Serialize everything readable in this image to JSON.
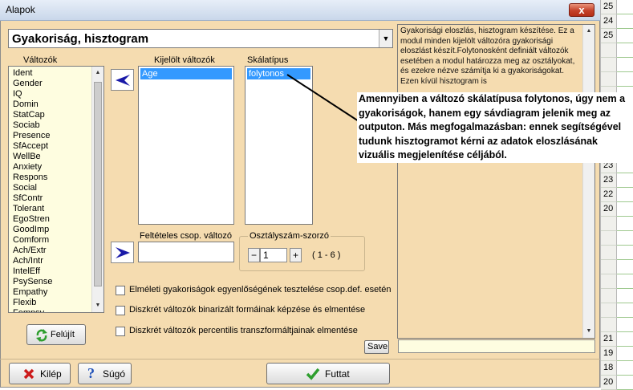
{
  "window": {
    "title": "Alapok",
    "close_label": "x"
  },
  "module_select": {
    "value": "Gyakoriság, hisztogram"
  },
  "variables": {
    "label": "Változók",
    "items": [
      "Ident",
      "Gender",
      "IQ",
      "Domin",
      "StatCap",
      "Sociab",
      "Presence",
      "SfAccept",
      "WellBe",
      "Anxiety",
      "Respons",
      "Social",
      "SfContr",
      "Tolerant",
      "EgoStren",
      "GoodImp",
      "Comform",
      "Ach/Extr",
      "Ach/Intr",
      "IntelEff",
      "PsySense",
      "Empathy",
      "Flexib",
      "Fempsy"
    ]
  },
  "selected_variables": {
    "label": "Kijelölt változók",
    "items": [
      "Age"
    ]
  },
  "scale_type": {
    "label": "Skálatípus",
    "items": [
      "folytonos"
    ]
  },
  "conditional": {
    "label": "Feltételes csop. változó",
    "value": ""
  },
  "class_multiplier": {
    "label": "Osztályszám-szorzó",
    "value": "1",
    "minus": "−",
    "plus": "+",
    "range": "( 1 - 6 )"
  },
  "options": [
    {
      "label": "Elméleti gyakoriságok egyenlőségének tesztelése csop.def. esetén",
      "checked": false
    },
    {
      "label": "Diszkrét változók binarizált formáinak képzése és elmentése",
      "checked": false
    },
    {
      "label": "Diszkrét változók percentilis transzformáltjainak elmentése",
      "checked": false
    }
  ],
  "buttons": {
    "refresh": "Felújít",
    "save": "Save",
    "exit": "Kilép",
    "help": "Súgó",
    "run": "Futtat"
  },
  "description": "Gyakorisági eloszlás, hisztogram készítése. Ez a modul minden kijelölt változóra gyakorisági eloszlást készít.Folytonosként definiált változók esetében a modul határozza meg az osztályokat, és ezekre nézve számítja ki a gyakoriságokat. Ezen kívül hisztogram is",
  "annotation": "Amennyiben a változó skálatípusa folytonos, úgy nem a gyakoriságok, hanem egy sávdiagram jelenik meg az outputon. Más megfogalmazásban: ennek segítségével tudunk hisztogramot kérni az adatok eloszlásának vizuális megjelenítése céljából.",
  "sheet_rows": [
    "25",
    "24",
    "25",
    "",
    "",
    "",
    "",
    "",
    "",
    "",
    "",
    "23",
    "23",
    "22",
    "20",
    "",
    "",
    "",
    "",
    "",
    "",
    "",
    "",
    "21",
    "19",
    "18",
    "20"
  ],
  "colors": {
    "panel": "#f5dcb0",
    "selection": "#3399ff",
    "arrow": "#1a1aa8",
    "check": "#2e9e2e",
    "close": "#c4412a"
  }
}
